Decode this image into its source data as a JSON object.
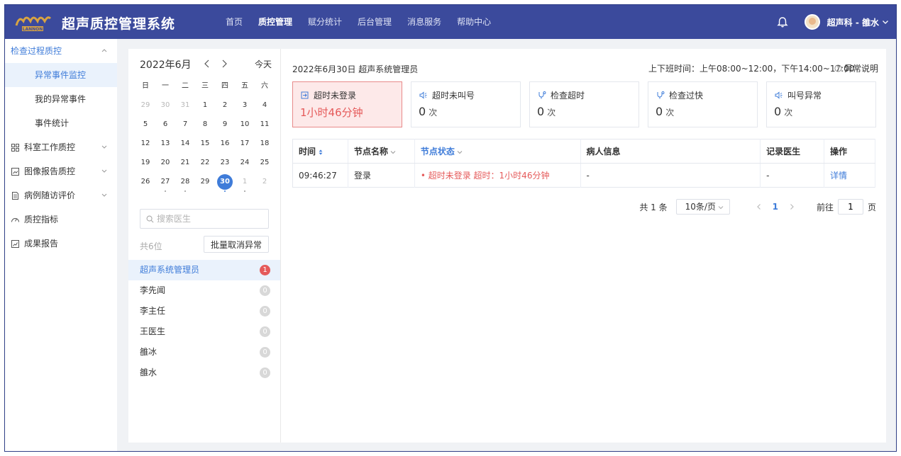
{
  "header": {
    "logo_text": "LANNON",
    "title": "超声质控管理系统",
    "nav": [
      {
        "label": "首页"
      },
      {
        "label": "质控管理"
      },
      {
        "label": "赋分统计"
      },
      {
        "label": "后台管理"
      },
      {
        "label": "消息服务"
      },
      {
        "label": "帮助中心"
      }
    ],
    "active_nav": 1,
    "user": "超声科 - 雒水"
  },
  "sidebar": {
    "groups": [
      {
        "label": "检查过程质控",
        "icon": "none",
        "open": true,
        "subs": [
          {
            "label": "异常事件监控"
          },
          {
            "label": "我的异常事件"
          },
          {
            "label": "事件统计"
          }
        ]
      },
      {
        "label": "科室工作质控",
        "icon": "grid-icon"
      },
      {
        "label": "图像报告质控",
        "icon": "image-report-icon"
      },
      {
        "label": "病例随访评价",
        "icon": "doc-icon"
      },
      {
        "label": "质控指标",
        "icon": "gauge-icon"
      },
      {
        "label": "成果报告",
        "icon": "chart-report-icon"
      }
    ]
  },
  "calendar": {
    "title": "2022年6月",
    "today": "今天",
    "weekdays": [
      "日",
      "一",
      "二",
      "三",
      "四",
      "五",
      "六"
    ],
    "weeks": [
      [
        "29",
        "30",
        "31",
        "1",
        "2",
        "3",
        "4"
      ],
      [
        "5",
        "6",
        "7",
        "8",
        "9",
        "10",
        "11"
      ],
      [
        "12",
        "13",
        "14",
        "15",
        "16",
        "17",
        "18"
      ],
      [
        "19",
        "20",
        "21",
        "22",
        "23",
        "24",
        "25"
      ],
      [
        "26",
        "27",
        "28",
        "29",
        "30",
        "1",
        "2"
      ]
    ]
  },
  "doctors": {
    "search_placeholder": "搜索医生",
    "count": "共6位",
    "batch_label": "批量取消异常",
    "list": [
      {
        "name": "超声系统管理员",
        "count": "1"
      },
      {
        "name": "李先闻",
        "count": "0"
      },
      {
        "name": "李主任",
        "count": "0"
      },
      {
        "name": "王医生",
        "count": "0"
      },
      {
        "name": "雒冰",
        "count": "0"
      },
      {
        "name": "雒水",
        "count": "0"
      }
    ]
  },
  "main": {
    "date_user": "2022年6月30日 超声系统管理员",
    "hours": "上下班时间：上午08:00~12:00，下午14:00~17:00",
    "help": "异常说明",
    "cards": [
      {
        "title": "超时未登录",
        "value": "1小时46分钟",
        "unit": ""
      },
      {
        "title": "超时未叫号",
        "value": "0",
        "unit": "次"
      },
      {
        "title": "检查超时",
        "value": "0",
        "unit": "次"
      },
      {
        "title": "检查过快",
        "value": "0",
        "unit": "次"
      },
      {
        "title": "叫号异常",
        "value": "0",
        "unit": "次"
      }
    ],
    "table": {
      "headers": [
        "时间",
        "节点名称",
        "节点状态",
        "病人信息",
        "记录医生",
        "操作"
      ],
      "rows": [
        {
          "time": "09:46:27",
          "node": "登录",
          "status": "• 超时未登录  超时：1小时46分钟",
          "patient": "-",
          "doctor": "-",
          "action": "详情"
        }
      ]
    },
    "pager": {
      "total": "共 1 条",
      "page_size": "10条/页",
      "current": "1",
      "goto_prefix": "前往",
      "goto_value": "1",
      "goto_suffix": "页"
    }
  },
  "colors": {
    "header_bg": "#3b4a9c",
    "accent": "#3f7cd9",
    "danger": "#e55a5a"
  }
}
